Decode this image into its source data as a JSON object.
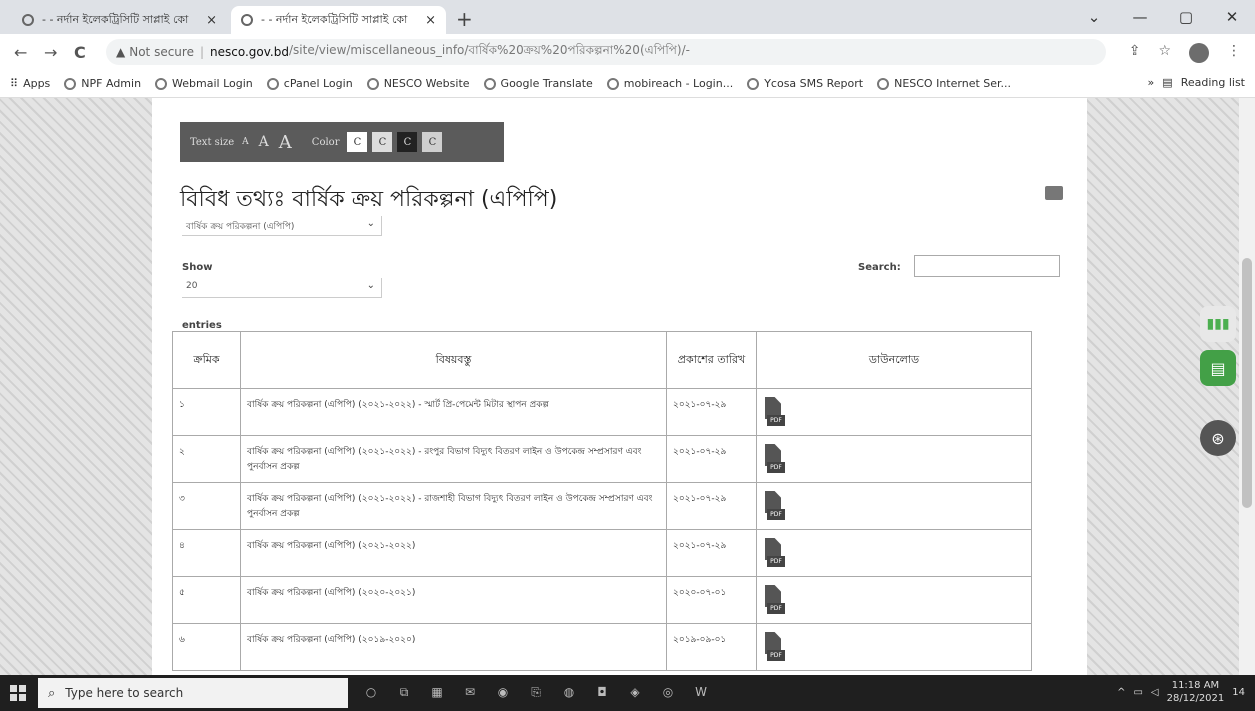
{
  "browser": {
    "tabs": [
      {
        "title": "- - নর্দান ইলেকট্রিসিটি সাপ্লাই কো",
        "close": "×"
      },
      {
        "title": "- - নর্দান ইলেকট্রিসিটি সাপ্লাই কো",
        "close": "×"
      }
    ],
    "new_tab": "+",
    "window_controls": {
      "minimize": "—",
      "maximize": "▢",
      "close": "✕",
      "dropdown": "⌄"
    },
    "nav": {
      "back": "←",
      "forward": "→",
      "reload": "C"
    },
    "address": {
      "warning": "▲",
      "not_secure": "Not secure",
      "separator": "|",
      "host": "nesco.gov.bd",
      "path": "/site/view/miscellaneous_info/বার্ষিক%20ক্রয়%20পরিকল্পনা%20(এপিপি)/-"
    },
    "address_icons": {
      "share": "⇪",
      "star": "☆",
      "menu": "⋮"
    },
    "bookmarks": [
      "Apps",
      "NPF Admin",
      "Webmail Login",
      "cPanel Login",
      "NESCO Website",
      "Google Translate",
      "mobireach - Login...",
      "Ycosa SMS Report",
      "NESCO Internet Ser..."
    ],
    "bookmarks_more": "»",
    "reading_list": "Reading list"
  },
  "toolbar": {
    "text_size_label": "Text size",
    "size_options": [
      "A",
      "A",
      "A"
    ],
    "color_label": "Color",
    "color_options": [
      {
        "label": "C",
        "bg": "#ffffff",
        "fg": "#333333"
      },
      {
        "label": "C",
        "bg": "#dddddd",
        "fg": "#333333"
      },
      {
        "label": "C",
        "bg": "#222222",
        "fg": "#dddddd"
      },
      {
        "label": "C",
        "bg": "#cfcfcf",
        "fg": "#333333"
      }
    ]
  },
  "page": {
    "title": "বিবিধ তথ্যঃ বার্ষিক ক্রয় পরিকল্পনা (এপিপি)",
    "category_select": "বার্ষিক ক্রয় পরিকল্পনা (এপিপি)",
    "show_label": "Show",
    "show_value": "20",
    "entries_label": "entries",
    "search_label": "Search:",
    "search_value": ""
  },
  "table": {
    "headers": [
      "ক্রমিক",
      "বিষয়বস্তু",
      "প্রকাশের তারিখ",
      "ডাউনলোড"
    ],
    "pdf_label": "PDF",
    "rows": [
      {
        "serial": "১",
        "subject": "বার্ষিক ক্রয় পরিকল্পনা (এপিপি) (২০২১-২০২২) - স্মার্ট প্রি-পেমেন্ট মিটার স্থাপন প্রকল্প",
        "date": "২০২১-০৭-২৯"
      },
      {
        "serial": "২",
        "subject": "বার্ষিক ক্রয় পরিকল্পনা (এপিপি) (২০২১-২০২২) - রংপুর বিভাগ বিদ্যুৎ বিতরণ লাইন ও উপকেন্দ্র সম্প্রসারণ এবং পুনর্বাসন প্রকল্প",
        "date": "২০২১-০৭-২৯"
      },
      {
        "serial": "৩",
        "subject": "বার্ষিক ক্রয় পরিকল্পনা (এপিপি) (২০২১-২০২২) - রাজশাহী বিভাগ বিদ্যুৎ বিতরণ লাইন ও উপকেন্দ্র সম্প্রসারণ এবং পুনর্বাসন প্রকল্প",
        "date": "২০২১-০৭-২৯"
      },
      {
        "serial": "৪",
        "subject": "বার্ষিক ক্রয় পরিকল্পনা (এপিপি) (২০২১-২০২২)",
        "date": "২০২১-০৭-২৯"
      },
      {
        "serial": "৫",
        "subject": "বার্ষিক ক্রয় পরিকল্পনা (এপিপি) (২০২০-২০২১)",
        "date": "২০২০-০৭-০১"
      },
      {
        "serial": "৬",
        "subject": "বার্ষিক ক্রয় পরিকল্পনা (এপিপি) (২০১৯-২০২০)",
        "date": "২০১৯-০৯-০১"
      }
    ]
  },
  "side_widgets": [
    {
      "name": "stats-icon",
      "bg": "#4caf50"
    },
    {
      "name": "chat-icon",
      "bg": "#43a047"
    },
    {
      "name": "accessibility-icon",
      "bg": "#555555"
    }
  ],
  "taskbar": {
    "search_placeholder": "Type here to search",
    "time": "11:18 AM",
    "date": "28/12/2021",
    "notifications": "14"
  }
}
